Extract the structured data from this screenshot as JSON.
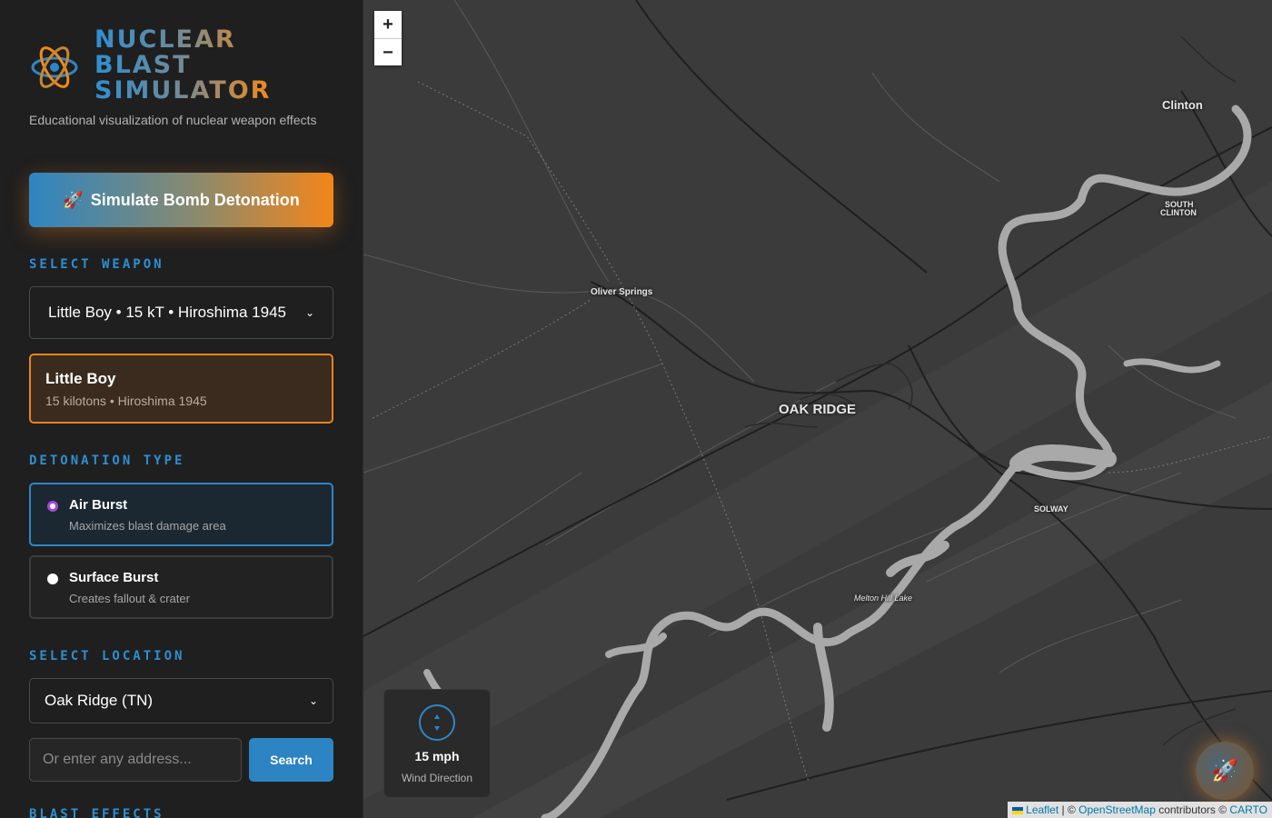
{
  "sidebar": {
    "brand": {
      "line1": "NUCLEAR",
      "line2": "BLAST",
      "line3": "SIMULATOR"
    },
    "tagline": "Educational visualization of nuclear weapon effects",
    "cta_label": "Simulate Bomb Detonation",
    "cta_icon": "rocket-icon",
    "sections": {
      "weapon": "SELECT WEAPON",
      "detonation": "DETONATION TYPE",
      "location": "SELECT LOCATION",
      "effects": "BLAST EFFECTS"
    },
    "weapon_select": {
      "value": "Little Boy • 15 kT • Hiroshima 1945"
    },
    "weapon_card": {
      "name": "Little Boy",
      "meta": "15 kilotons • Hiroshima 1945"
    },
    "detonation_options": [
      {
        "label": "Air Burst",
        "sub": "Maximizes blast damage area",
        "selected": true
      },
      {
        "label": "Surface Burst",
        "sub": "Creates fallout & crater",
        "selected": false
      }
    ],
    "location_select": {
      "value": "Oak Ridge (TN)"
    },
    "address": {
      "placeholder": "Or enter any address...",
      "value": ""
    },
    "search_label": "Search"
  },
  "map": {
    "zoom_in": "+",
    "zoom_out": "−",
    "places": {
      "clinton": "Clinton",
      "south_clinton_1": "SOUTH",
      "south_clinton_2": "CLINTON",
      "oliver_springs": "Oliver Springs",
      "oak_ridge": "OAK RIDGE",
      "solway": "SOLWAY",
      "melton": "Melton Hill Lake"
    },
    "wind": {
      "speed": "15 mph",
      "label": "Wind Direction"
    },
    "attribution": {
      "leaflet": "Leaflet",
      "sep": " | © ",
      "osm": "OpenStreetMap",
      "contrib": " contributors © ",
      "carto": "CARTO"
    }
  },
  "colors": {
    "accent_blue": "#2d86c7",
    "accent_orange": "#f08a1c",
    "map_bg": "#3b3b3b",
    "water": "#a9a9a9"
  }
}
